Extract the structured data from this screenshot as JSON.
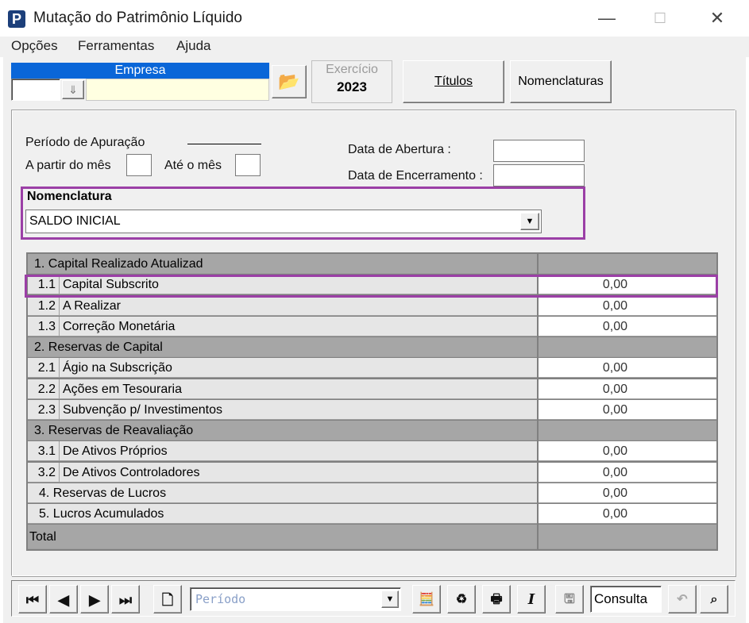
{
  "window": {
    "title": "Mutação do Patrimônio Líquido",
    "app_icon": "P",
    "minimize": "—",
    "maximize": "☐",
    "close": "✕"
  },
  "menu": [
    "Opções",
    "Ferramentas",
    "Ajuda"
  ],
  "header": {
    "empresa_label": "Empresa",
    "empresa_code": "",
    "empresa_name": "",
    "exercicio_label": "Exercício",
    "exercicio_value": "2023",
    "titulos_label": "Títulos",
    "nomenclaturas_label": "Nomenclaturas"
  },
  "period": {
    "title": "Período de Apuração",
    "from_label": "A partir do mês",
    "from_value": "",
    "to_label": "Até o mês",
    "to_value": "",
    "abertura_label": "Data de Abertura :",
    "abertura_value": "",
    "encerramento_label": "Data de Encerramento :",
    "encerramento_value": ""
  },
  "nomenclatura": {
    "label": "Nomenclatura",
    "selected": "SALDO INICIAL"
  },
  "grid": {
    "rows": [
      {
        "section": true,
        "num": "",
        "text": "1. Capital Realizado Atualizad",
        "value": ""
      },
      {
        "section": false,
        "num": "1.1",
        "text": "Capital Subscrito",
        "value": "0,00"
      },
      {
        "section": false,
        "num": "1.2",
        "text": "A Realizar",
        "value": "0,00"
      },
      {
        "section": false,
        "num": "1.3",
        "text": "Correção Monetária",
        "value": "0,00"
      },
      {
        "section": true,
        "num": "",
        "text": "2. Reservas  de Capital",
        "value": ""
      },
      {
        "section": false,
        "num": "2.1",
        "text": "Ágio na Subscrição",
        "value": "0,00"
      },
      {
        "section": false,
        "num": "2.2",
        "text": "Ações em Tesouraria",
        "value": "0,00"
      },
      {
        "section": false,
        "num": "2.3",
        "text": "Subvenção p/ Investimentos",
        "value": "0,00"
      },
      {
        "section": true,
        "num": "",
        "text": "3. Reservas de Reavaliação",
        "value": ""
      },
      {
        "section": false,
        "num": "3.1",
        "text": "De Ativos Próprios",
        "value": "0,00"
      },
      {
        "section": false,
        "num": "3.2",
        "text": "De Ativos Controladores",
        "value": "0,00"
      },
      {
        "section": false,
        "num": "",
        "text": "4. Reservas de Lucros",
        "value": "0,00"
      },
      {
        "section": false,
        "num": "",
        "text": "5. Lucros Acumulados",
        "value": "0,00"
      }
    ],
    "total_label": "Total",
    "total_value": ""
  },
  "toolbar": {
    "periodo_placeholder": "Período",
    "mode": "Consulta"
  },
  "colors": {
    "highlight": "#9b3fa6",
    "empresa_header": "#0a66d8",
    "empresa_field": "#ffffe1"
  }
}
